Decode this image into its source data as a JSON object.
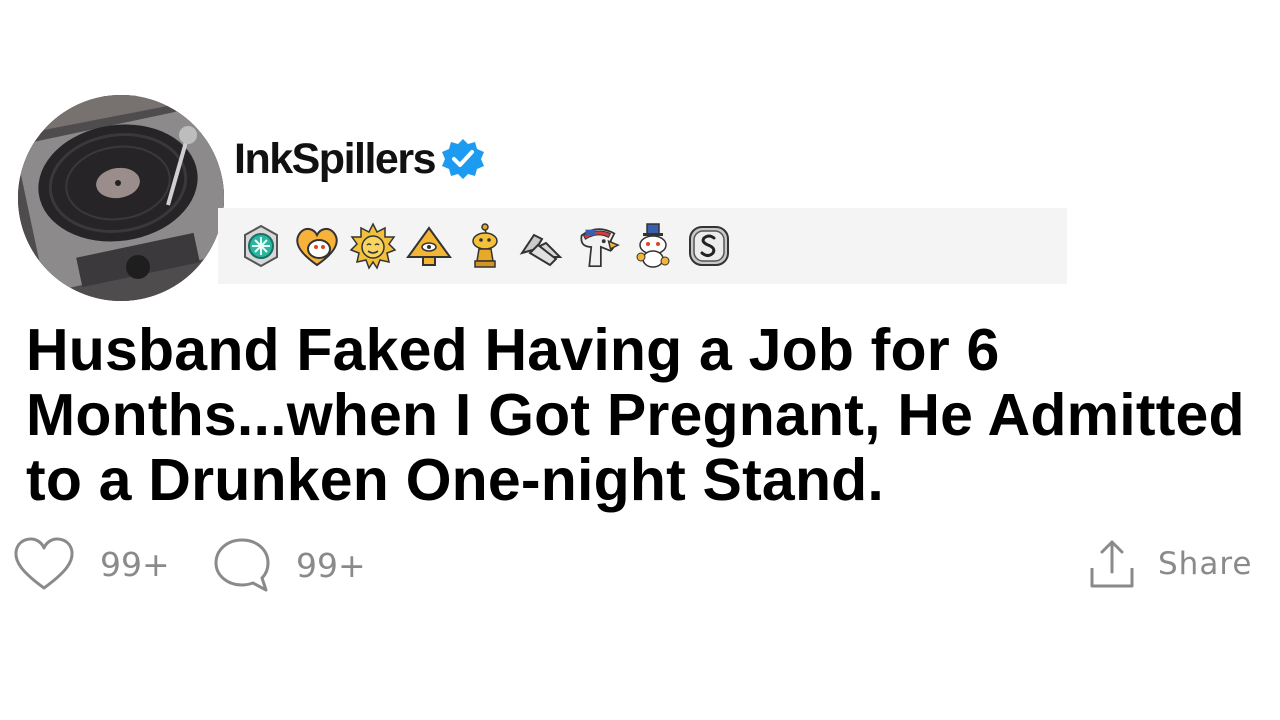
{
  "post": {
    "username": "InkSpillers",
    "title": "Husband Faked Having a Job for 6 Months...when I Got Pregnant, He Admitted to a Drunken One-night Stand."
  },
  "awards": [
    {
      "icon": "helpful-award-icon"
    },
    {
      "icon": "heart-snoo-icon"
    },
    {
      "icon": "sun-face-icon"
    },
    {
      "icon": "pyramid-eye-icon"
    },
    {
      "icon": "gold-snoo-trophy-icon"
    },
    {
      "icon": "handshake-icon"
    },
    {
      "icon": "eagle-icon"
    },
    {
      "icon": "snoo-uncle-sam-icon"
    },
    {
      "icon": "silver-s-coin-icon"
    }
  ],
  "actions": {
    "likes": "99+",
    "comments": "99+",
    "share_label": "Share"
  },
  "colors": {
    "verified_badge": "#1d9bf0",
    "action_gray": "#8a8a8a",
    "awards_strip_bg": "#f4f4f4"
  }
}
